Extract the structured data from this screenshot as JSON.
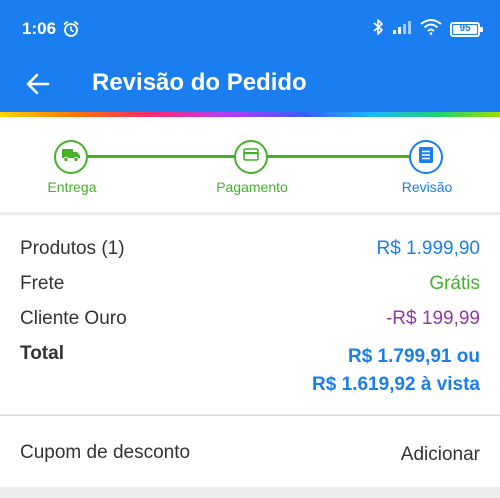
{
  "status_bar": {
    "time": "1:06",
    "battery": "95"
  },
  "app_bar": {
    "title": "Revisão do Pedido"
  },
  "stepper": {
    "steps": [
      {
        "label": "Entrega",
        "icon": "truck-icon",
        "state": "complete"
      },
      {
        "label": "Pagamento",
        "icon": "credit-card-icon",
        "state": "complete"
      },
      {
        "label": "Revisão",
        "icon": "receipt-icon",
        "state": "current"
      }
    ]
  },
  "summary": {
    "products_label": "Produtos (1)",
    "products_value": "R$ 1.999,90",
    "shipping_label": "Frete",
    "shipping_value": "Grátis",
    "gold_label": "Cliente Ouro",
    "gold_value": "-R$ 199,99",
    "total_label": "Total",
    "total_installment": "R$ 1.799,91 ou",
    "total_cash": "R$ 1.619,92 à vista"
  },
  "coupon": {
    "label": "Cupom de desconto",
    "action": "Adicionar"
  },
  "colors": {
    "primary": "#1a7ef0",
    "success": "#45b12a",
    "discount": "#8e3aa8"
  }
}
